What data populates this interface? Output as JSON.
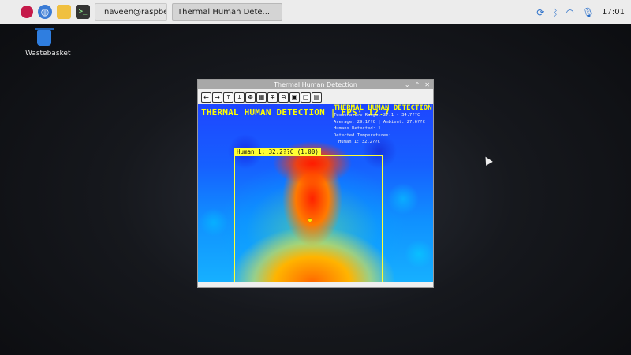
{
  "taskbar": {
    "terminal_task": "naveen@raspberrypi...",
    "app_task": "Thermal Human Dete...",
    "clock": "17:01"
  },
  "desktop": {
    "wastebasket_label": "Wastebasket"
  },
  "window": {
    "title": "Thermal Human Detection",
    "controls": [
      "⌄",
      "⌃",
      "✕"
    ],
    "toolbar": [
      "←",
      "→",
      "↑",
      "↓",
      "✥",
      "▦",
      "⊕",
      "⊖",
      "▣",
      "▢",
      "▤"
    ]
  },
  "overlay": {
    "header": "THERMAL HUMAN DETECTION | FPS: 12.7",
    "panel_title": "THERMAL HUMAN DETECTION",
    "temp_range": "Temperature Range: 27.1 - 34.7??C",
    "average": "Average: 29.1??C | Ambient: 27.6??C",
    "humans": "Humans Detected: 1",
    "detected_heading": "Detected Temperatures:",
    "detected_item": "Human 1: 32.2??C",
    "bbox_label": "Human 1: 32.2??C (1.00)"
  },
  "colors": {
    "accent_yellow": "#ffff00",
    "taskbar_bg": "#ececec"
  }
}
